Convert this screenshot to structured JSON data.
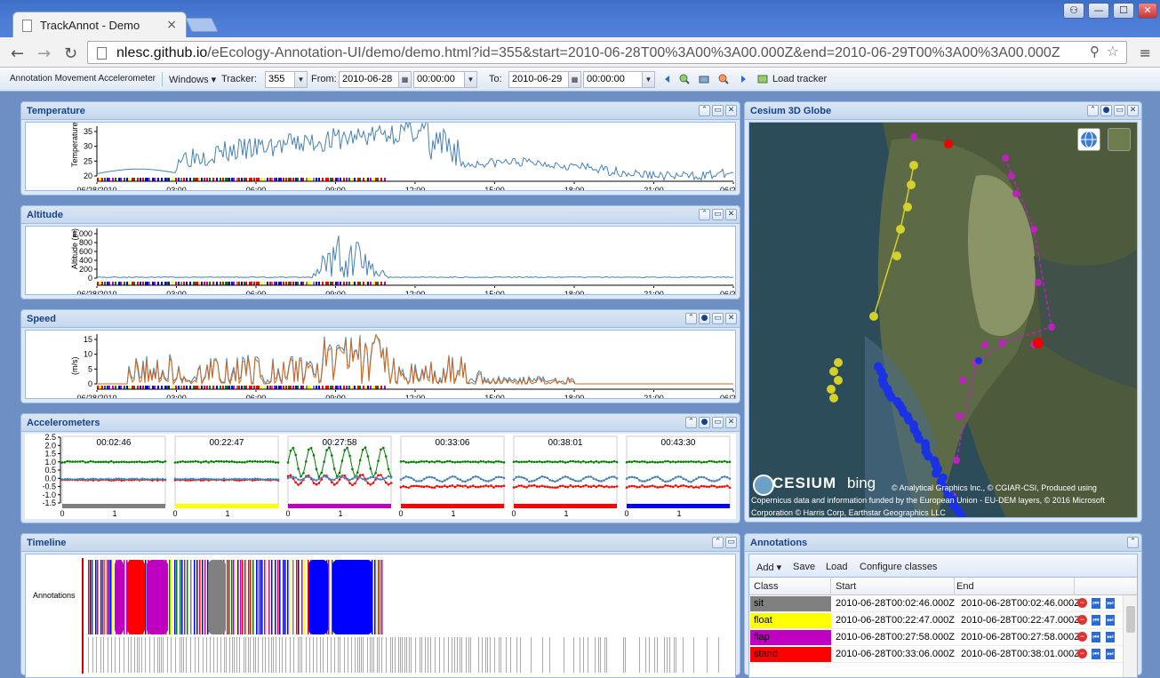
{
  "browser": {
    "tab_title": "TrackAnnot - Demo",
    "tab_close": "×",
    "url_host": "nlesc.github.io",
    "url_path": "/eEcology-Annotation-UI/demo/demo.html?id=355&start=2010-06-28T00%3A00%3A00.000Z&end=2010-06-29T00%3A00%3A00.000Z",
    "back": "←",
    "forward": "→",
    "reload": "↻",
    "zoom_icon": "⚲",
    "star": "☆",
    "menu": "≡",
    "win_user": "👤",
    "win_min": "—",
    "win_max": "☐",
    "win_close": "✕"
  },
  "apptoolbar": {
    "app_title": "Annotation Movement Accelerometer",
    "windows_label": "Windows ▾",
    "tracker_label": "Tracker:",
    "tracker_value": "355",
    "from_label": "From:",
    "from_date": "2010-06-28",
    "from_time": "00:00:00",
    "to_label": "To:",
    "to_date": "2010-06-29",
    "to_time": "00:00:00",
    "load_label": "Load tracker"
  },
  "panels": {
    "temperature": {
      "title": "Temperature",
      "ylabel": "Temperature (°C)",
      "yticks": [
        "35",
        "30",
        "25",
        "20"
      ]
    },
    "altitude": {
      "title": "Altitude",
      "ylabel": "Altitude (m)",
      "yticks": [
        "1,000",
        "800",
        "600",
        "400",
        "200",
        "0"
      ]
    },
    "speed": {
      "title": "Speed",
      "ylabel": "(m/s)",
      "yticks": [
        "15",
        "10",
        "5",
        "0"
      ]
    },
    "accelerometers": {
      "title": "Accelerometers",
      "yticks": [
        "2.5",
        "2.0",
        "1.5",
        "1.0",
        "0.5",
        "0.0",
        "-0.5",
        "-1.0",
        "-1.5"
      ],
      "xticks": [
        "0",
        "1"
      ],
      "bursts": [
        {
          "time": "00:02:46",
          "color": "#808080"
        },
        {
          "time": "00:22:47",
          "color": "#ffff00"
        },
        {
          "time": "00:27:58",
          "color": "#c000c0"
        },
        {
          "time": "00:33:06",
          "color": "#ff0000"
        },
        {
          "time": "00:38:01",
          "color": "#ff0000"
        },
        {
          "time": "00:43:30",
          "color": "#0000ff"
        }
      ]
    },
    "globe": {
      "title": "Cesium 3D Globe",
      "cesium_logo": "CESIUM",
      "bing_logo": "bing",
      "credit_line1": "© Analytical Graphics Inc., © CGIAR-CSI, Produced using",
      "credit_line2": "Copernicus data and information funded by the European Union - EU-DEM layers, © 2016 Microsoft",
      "credit_line3": "Corporation © Harris Corp, Earthstar Geographics LLC"
    },
    "timeline": {
      "title": "Timeline",
      "row_label": "Annotations"
    },
    "annotations": {
      "title": "Annotations",
      "toolbar": {
        "add": "Add ▾",
        "save": "Save",
        "load": "Load",
        "configure": "Configure classes"
      },
      "columns": [
        "Class",
        "Start",
        "End"
      ],
      "rows": [
        {
          "class": "sit",
          "color": "#808080",
          "start": "2010-06-28T00:02:46.000Z",
          "end": "2010-06-28T00:02:46.000Z"
        },
        {
          "class": "float",
          "color": "#ffff00",
          "start": "2010-06-28T00:22:47.000Z",
          "end": "2010-06-28T00:22:47.000Z"
        },
        {
          "class": "flap",
          "color": "#c000c0",
          "start": "2010-06-28T00:27:58.000Z",
          "end": "2010-06-28T00:27:58.000Z"
        },
        {
          "class": "stand",
          "color": "#ff0000",
          "start": "2010-06-28T00:33:06.000Z",
          "end": "2010-06-28T00:38:01.000Z"
        }
      ]
    }
  },
  "time_axis": [
    "06/28/2010",
    "03:00",
    "06:00",
    "09:00",
    "12:00",
    "15:00",
    "18:00",
    "21:00",
    "06/29/2"
  ],
  "colors": {
    "series_blue": "#4682b4",
    "series_orange": "#d2691e",
    "acc_green": "#008000",
    "acc_red": "#ff0000",
    "header_text": "#15428b"
  }
}
